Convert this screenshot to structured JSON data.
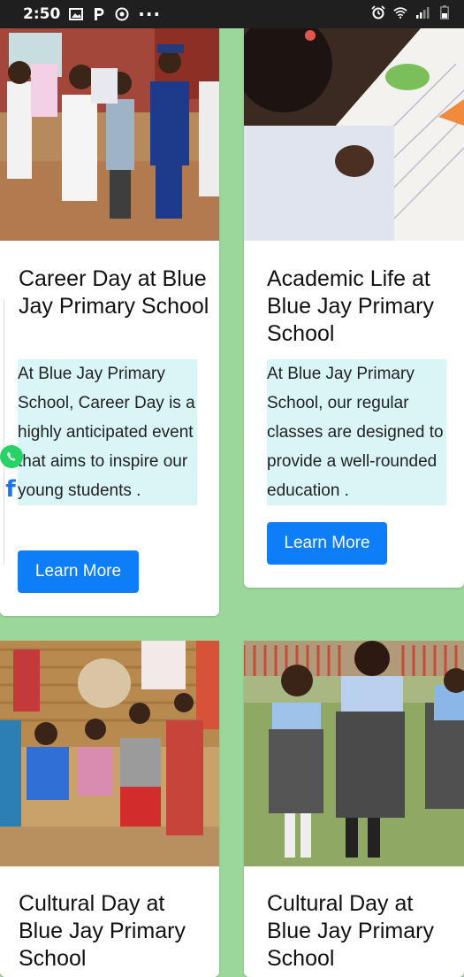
{
  "status_bar": {
    "time": "2:50",
    "left_icons": [
      "gallery-icon",
      "parking-p-icon",
      "circle-app-icon",
      "more-dots-icon"
    ],
    "right_icons": [
      "alarm-icon",
      "wifi-icon",
      "signal-icon",
      "battery-icon"
    ],
    "more_label": "···"
  },
  "cards": [
    {
      "title": "Career Day at Blue Jay Primary School",
      "description": "At Blue Jay Primary School, Career Day is a highly anticipated event that aims to inspire our young students .",
      "button": "Learn More"
    },
    {
      "title": "Academic Life at Blue Jay Primary School",
      "description": "At Blue Jay Primary School, our regular classes are designed to provide a well-rounded education .",
      "button": "Learn More"
    },
    {
      "title": "Cultural Day at Blue Jay Primary School"
    },
    {
      "title": "Cultural Day at Blue Jay Primary School"
    }
  ],
  "floating": {
    "whatsapp_color": "#25d366",
    "facebook_color": "#1877f2",
    "facebook_glyph": "f"
  },
  "colors": {
    "page_background": "#9bd69a",
    "button_blue": "#0d7ef7",
    "description_highlight": "#d9f5f6"
  }
}
